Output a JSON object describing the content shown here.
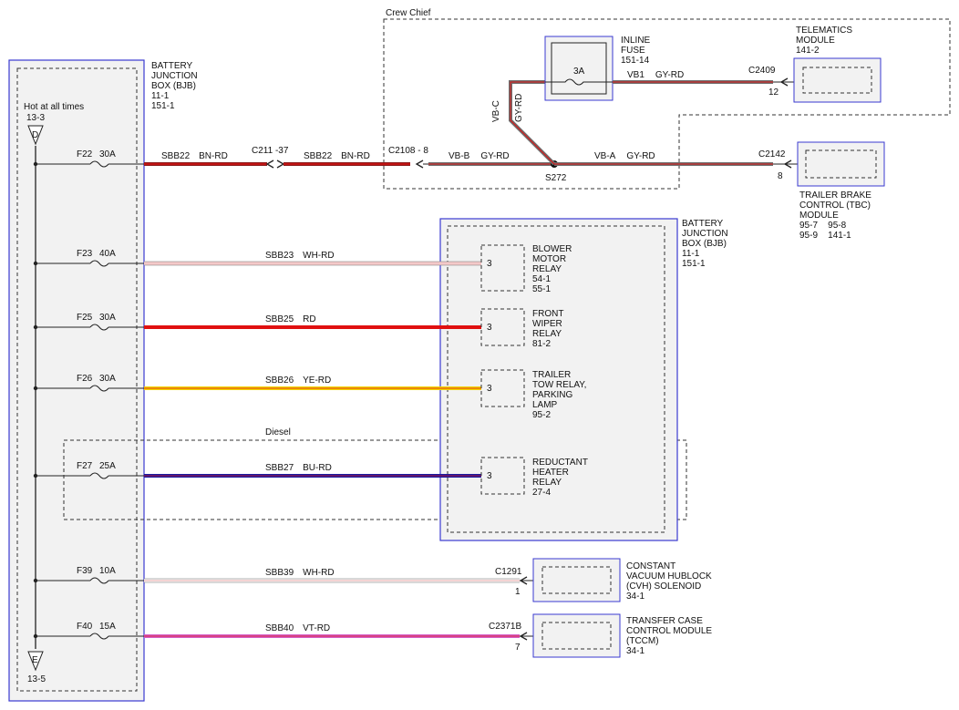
{
  "bjb_left": {
    "title": [
      "BATTERY",
      "JUNCTION",
      "BOX (BJB)",
      "11-1",
      "151-1"
    ],
    "hot_label": "Hot at all times",
    "hot_ref": "13-3",
    "top_connector": "D",
    "bottom_connector": "E",
    "bottom_ref": "13-5"
  },
  "crew_chief_label": "Crew Chief",
  "diesel_label": "Diesel",
  "fuses": [
    {
      "id": "F22",
      "rating": "30A"
    },
    {
      "id": "F23",
      "rating": "40A"
    },
    {
      "id": "F25",
      "rating": "30A"
    },
    {
      "id": "F26",
      "rating": "30A"
    },
    {
      "id": "F27",
      "rating": "25A"
    },
    {
      "id": "F39",
      "rating": "10A"
    },
    {
      "id": "F40",
      "rating": "15A"
    }
  ],
  "circuits": {
    "sbb22_a": {
      "circuit": "SBB22",
      "color": "BN-RD"
    },
    "c211": "C211 -37",
    "sbb22_b": {
      "circuit": "SBB22",
      "color": "BN-RD"
    },
    "c2108": "C2108 - 8",
    "vbb": {
      "circuit": "VB-B",
      "color": "GY-RD"
    },
    "vbc": {
      "circuit": "VB-C",
      "color": "GY-RD"
    },
    "vba": {
      "circuit": "VB-A",
      "color": "GY-RD"
    },
    "vb1": {
      "circuit": "VB1",
      "color": "GY-RD"
    },
    "splice": "S272",
    "c2142": {
      "connector": "C2142",
      "pin": "8"
    },
    "c2409": {
      "connector": "C2409",
      "pin": "12"
    },
    "sbb23": {
      "circuit": "SBB23",
      "color": "WH-RD"
    },
    "sbb25": {
      "circuit": "SBB25",
      "color": "RD"
    },
    "sbb26": {
      "circuit": "SBB26",
      "color": "YE-RD"
    },
    "sbb27": {
      "circuit": "SBB27",
      "color": "BU-RD"
    },
    "sbb39": {
      "circuit": "SBB39",
      "color": "WH-RD"
    },
    "sbb40": {
      "circuit": "SBB40",
      "color": "VT-RD"
    },
    "c1291": {
      "connector": "C1291",
      "pin": "1"
    },
    "c2371b": {
      "connector": "C2371B",
      "pin": "7"
    }
  },
  "inline_fuse": {
    "label": [
      "INLINE",
      "FUSE",
      "151-14"
    ],
    "rating": "3A"
  },
  "telematics": [
    "TELEMATICS",
    "MODULE",
    "141-2"
  ],
  "tbc": [
    "TRAILER BRAKE",
    "CONTROL (TBC)",
    "MODULE",
    "95-7    95-8",
    "95-9    141-1"
  ],
  "bjb_right": {
    "title": [
      "BATTERY",
      "JUNCTION",
      "BOX (BJB)",
      "11-1",
      "151-1"
    ]
  },
  "relays": [
    {
      "pin": "3",
      "label": [
        "BLOWER",
        "MOTOR",
        "RELAY",
        "54-1",
        "55-1"
      ]
    },
    {
      "pin": "3",
      "label": [
        "FRONT",
        "WIPER",
        "RELAY",
        "81-2"
      ]
    },
    {
      "pin": "3",
      "label": [
        "TRAILER",
        "TOW RELAY,",
        "PARKING",
        "LAMP",
        "95-2"
      ]
    },
    {
      "pin": "3",
      "label": [
        "REDUCTANT",
        "HEATER",
        "RELAY",
        "27-4"
      ]
    }
  ],
  "cvh": [
    "CONSTANT",
    "VACUUM HUBLOCK",
    "(CVH) SOLENOID",
    "34-1"
  ],
  "tccm": [
    "TRANSFER CASE",
    "CONTROL MODULE",
    "(TCCM)",
    "34-1"
  ],
  "colors": {
    "bn_rd": "#8b1a1a",
    "rd": "#e01010",
    "gy_rd": "#6e6e6e",
    "wh_rd": "#f4c8c8",
    "ye_rd": "#f2d400",
    "bu_rd": "#1a1aa0",
    "vt_rd": "#d45fc8",
    "box_border": "#3a3ad0",
    "box_fill": "#f2f2f2"
  }
}
